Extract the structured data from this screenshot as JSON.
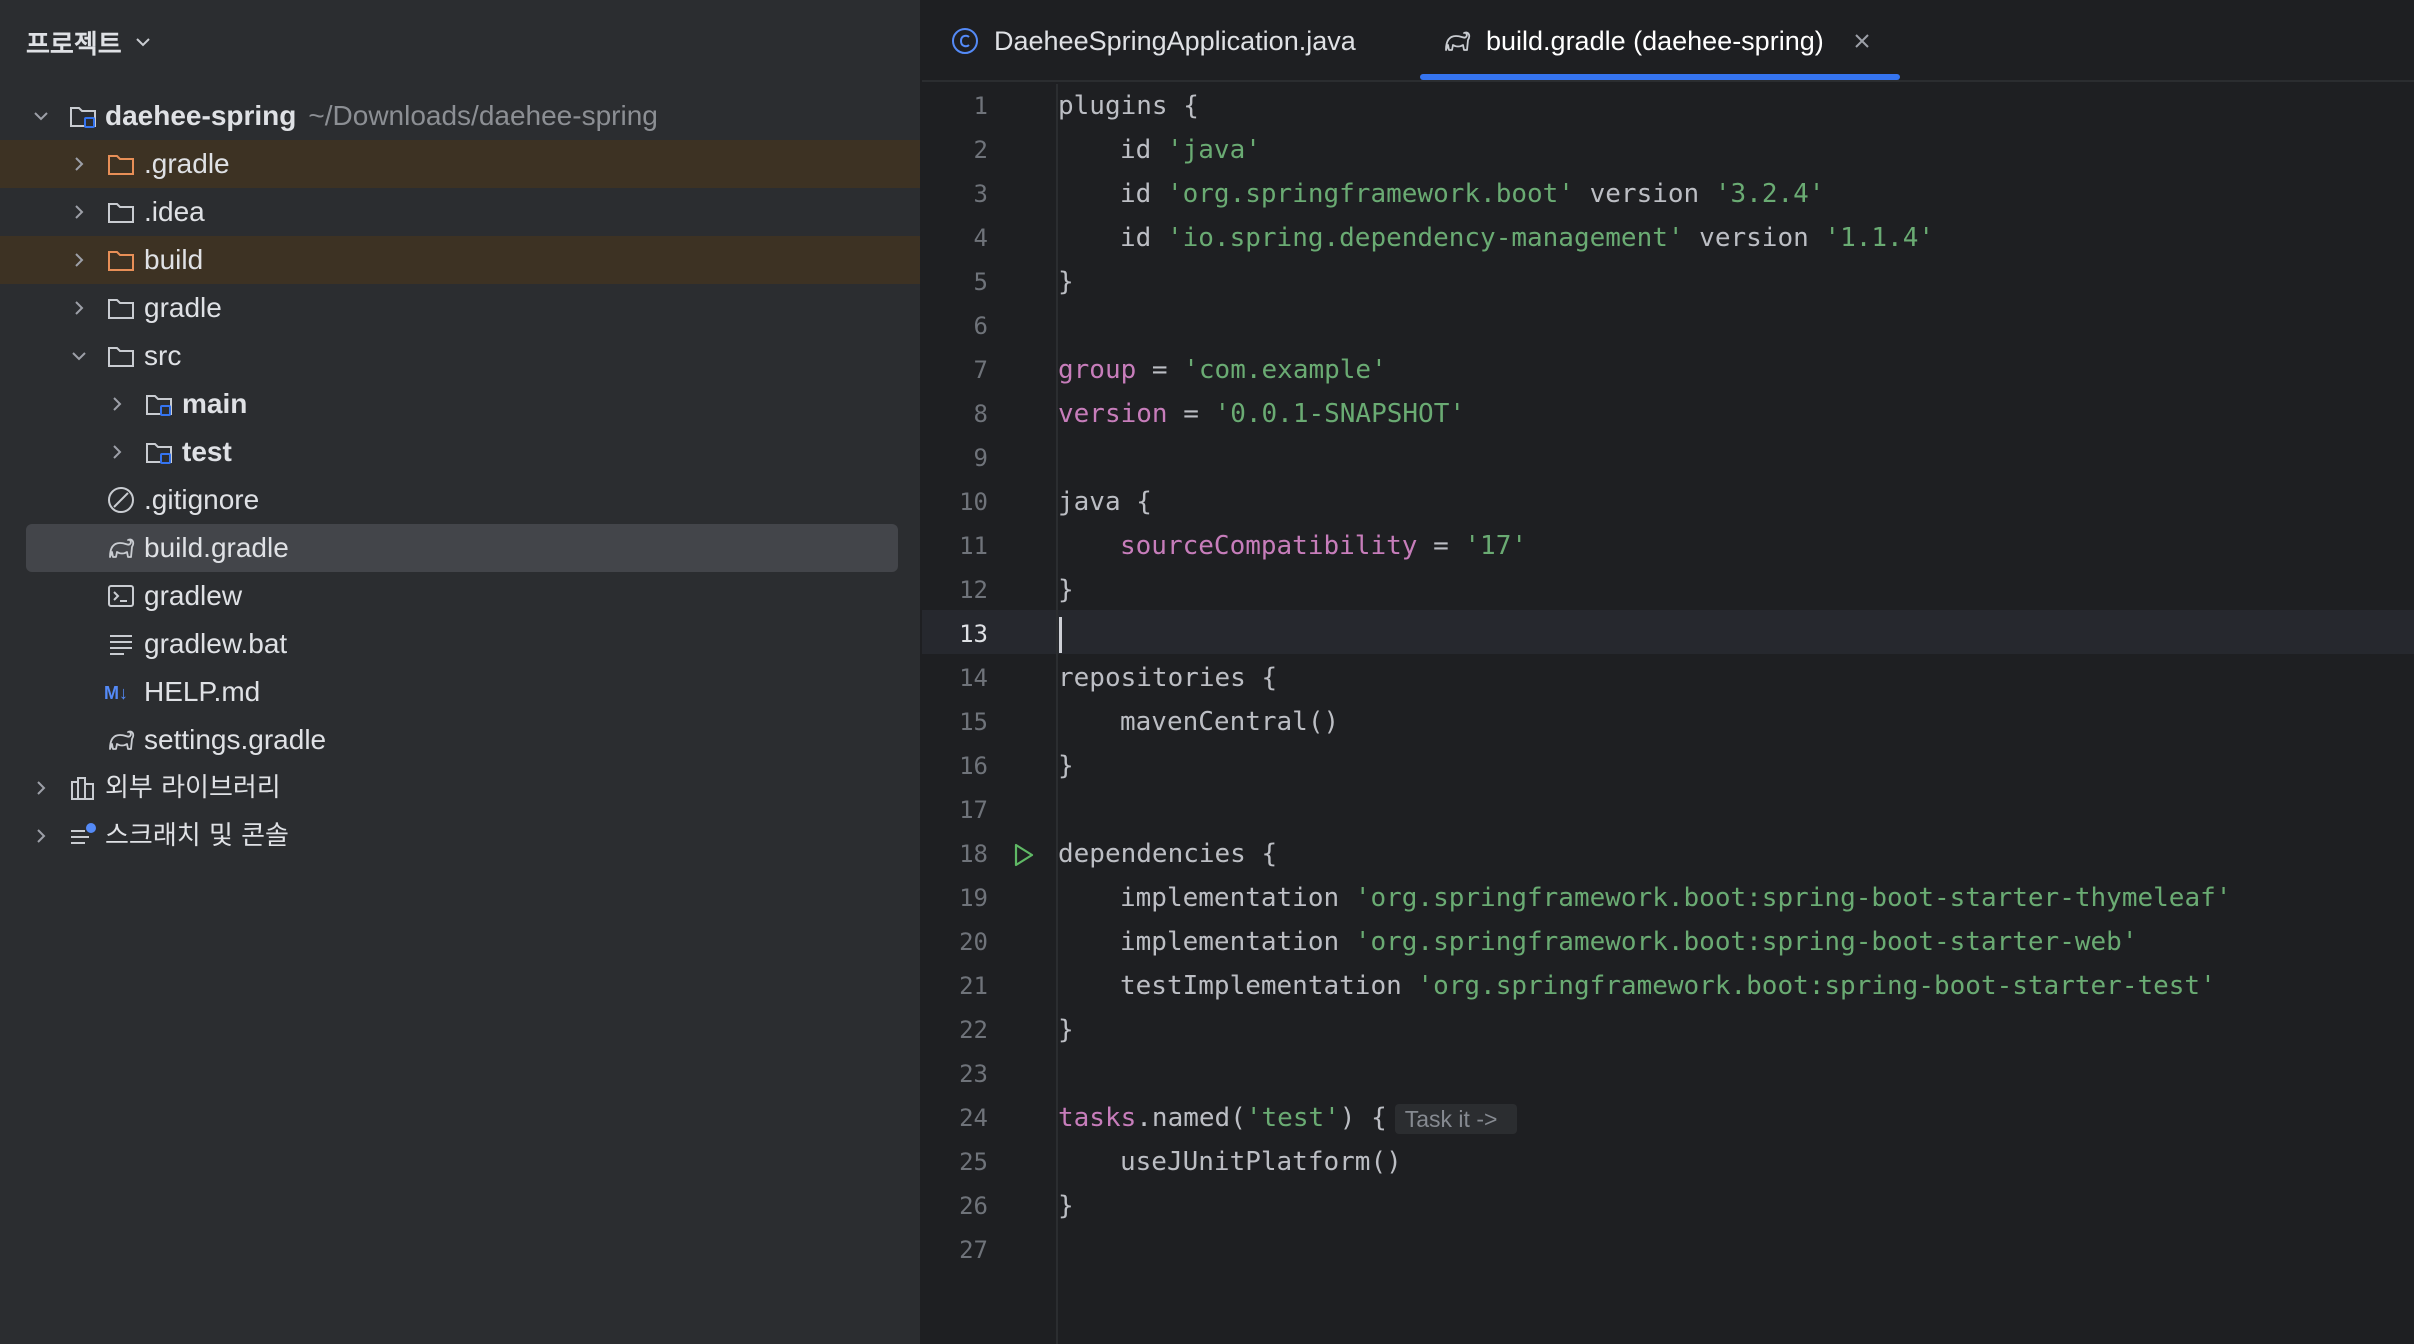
{
  "sidebar": {
    "title": "프로젝트",
    "tree": [
      {
        "label": "daehee-spring",
        "path": "~/Downloads/daehee-spring"
      },
      {
        "label": ".gradle"
      },
      {
        "label": ".idea"
      },
      {
        "label": "build"
      },
      {
        "label": "gradle"
      },
      {
        "label": "src"
      },
      {
        "label": "main"
      },
      {
        "label": "test"
      },
      {
        "label": ".gitignore"
      },
      {
        "label": "build.gradle"
      },
      {
        "label": "gradlew"
      },
      {
        "label": "gradlew.bat"
      },
      {
        "label": "HELP.md"
      },
      {
        "label": "settings.gradle"
      },
      {
        "label": "외부 라이브러리"
      },
      {
        "label": "스크래치 및 콘솔"
      }
    ]
  },
  "tabs": [
    {
      "label": "DaeheeSpringApplication.java"
    },
    {
      "label": "build.gradle (daehee-spring)"
    }
  ],
  "editor": {
    "line_numbers": [
      "1",
      "2",
      "3",
      "4",
      "5",
      "6",
      "7",
      "8",
      "9",
      "10",
      "11",
      "12",
      "13",
      "14",
      "15",
      "16",
      "17",
      "18",
      "19",
      "20",
      "21",
      "22",
      "23",
      "24",
      "25",
      "26",
      "27"
    ],
    "current_line": 13,
    "code": {
      "l1": {
        "a": "plugins {"
      },
      "l2": {
        "a": "id ",
        "b": "'java'"
      },
      "l3": {
        "a": "id ",
        "b": "'org.springframework.boot'",
        "c": " version ",
        "d": "'3.2.4'"
      },
      "l4": {
        "a": "id ",
        "b": "'io.spring.dependency-management'",
        "c": " version ",
        "d": "'1.1.4'"
      },
      "l5": {
        "a": "}"
      },
      "l7": {
        "a": "group",
        "b": " = ",
        "c": "'com.example'"
      },
      "l8": {
        "a": "version",
        "b": " = ",
        "c": "'0.0.1-SNAPSHOT'"
      },
      "l10": {
        "a": "java {"
      },
      "l11": {
        "a": "sourceCompatibility",
        "b": " = ",
        "c": "'17'"
      },
      "l12": {
        "a": "}"
      },
      "l14": {
        "a": "repositories {"
      },
      "l15": {
        "a": "mavenCentral()"
      },
      "l16": {
        "a": "}"
      },
      "l18": {
        "a": "dependencies {"
      },
      "l19": {
        "a": "implementation ",
        "b": "'org.springframework.boot:spring-boot-starter-thymeleaf'"
      },
      "l20": {
        "a": "implementation ",
        "b": "'org.springframework.boot:spring-boot-starter-web'"
      },
      "l21": {
        "a": "testImplementation ",
        "b": "'org.springframework.boot:spring-boot-starter-test'"
      },
      "l22": {
        "a": "}"
      },
      "l24": {
        "a": "tasks",
        "b": ".named(",
        "c": "'test'",
        "d": ") {",
        "hint": "Task it ->"
      },
      "l25": {
        "a": "useJUnitPlatform()"
      },
      "l26": {
        "a": "}"
      }
    }
  },
  "colors": {
    "background": "#1e1f22",
    "sidebar": "#2b2d30",
    "accent": "#3574f0",
    "string": "#6aab73",
    "property": "#c77dbb",
    "folder_excluded": "#e88f57",
    "run": "#5fb865"
  },
  "icons": {
    "folder": "folder-icon",
    "module": "module-folder-icon",
    "gradle": "gradle-elephant-icon",
    "ignore": "gitignore-icon",
    "terminal": "terminal-icon",
    "text": "text-file-icon",
    "markdown": "markdown-icon",
    "library": "library-icon",
    "scratch": "scratch-icon",
    "java_class": "java-class-icon",
    "run": "run-gutter-icon",
    "close": "close-icon"
  }
}
